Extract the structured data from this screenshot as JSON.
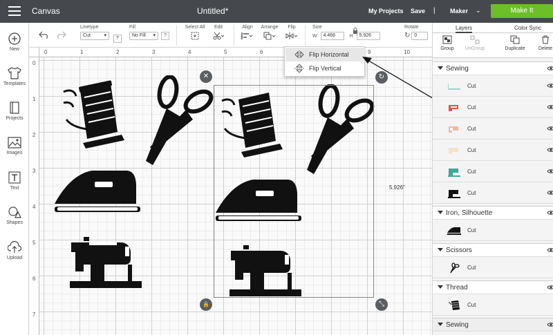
{
  "topbar": {
    "app_label": "Canvas",
    "doc_title": "Untitled*",
    "my_projects": "My Projects",
    "save": "Save",
    "separator": "|",
    "machine": "Maker",
    "machine_chevron": "⌄",
    "make_it": "Make It"
  },
  "left_tools": [
    {
      "label": "New",
      "icon": "plus-circle-icon"
    },
    {
      "label": "Templates",
      "icon": "shirt-icon"
    },
    {
      "label": "Projects",
      "icon": "book-icon"
    },
    {
      "label": "Images",
      "icon": "image-icon"
    },
    {
      "label": "Text",
      "icon": "text-icon"
    },
    {
      "label": "Shapes",
      "icon": "shapes-icon"
    },
    {
      "label": "Upload",
      "icon": "upload-icon"
    }
  ],
  "toolbar": {
    "linetype_label": "Linetype",
    "linetype_value": "Cut",
    "fill_label": "Fill",
    "fill_value": "No Fill",
    "help": "?",
    "select_all": "Select All",
    "edit": "Edit",
    "align": "Align",
    "arrange": "Arrange",
    "flip": "Flip",
    "size_label": "Size",
    "w_label": "W",
    "w_value": "4.466",
    "h_label": "H",
    "h_value": "5.926",
    "rotate_label": "Rotate",
    "rotate_value": "0"
  },
  "ruler": {
    "h_ticks": [
      "0",
      "1",
      "2",
      "3",
      "4",
      "5",
      "6",
      "7",
      "8",
      "9",
      "10"
    ],
    "v_ticks": [
      "0",
      "1",
      "2",
      "3",
      "4",
      "5",
      "6",
      "7"
    ]
  },
  "selection": {
    "height_readout": "5.926\"",
    "close_glyph": "✕",
    "rotate_glyph": "↻",
    "lock_glyph": "🔒",
    "resize_glyph": "⤡"
  },
  "flip_menu": {
    "horizontal": "Flip Horizontal",
    "vertical": "Flip Vertical"
  },
  "panel": {
    "tab_layers": "Layers",
    "tab_color_sync": "Color Sync",
    "group": "Group",
    "ungroup": "UnGroup",
    "duplicate": "Duplicate",
    "delete": "Delete",
    "groups": [
      {
        "name": "Sewing",
        "rows": [
          {
            "label": "Cut",
            "color": "#9fd4c8"
          },
          {
            "label": "Cut",
            "color": "#e8524a"
          },
          {
            "label": "Cut",
            "color": "#f2b8a0"
          },
          {
            "label": "Cut",
            "color": "#f5e0c8"
          },
          {
            "label": "Cut",
            "color": "#3ea89a"
          },
          {
            "label": "Cut",
            "color": "#111111"
          }
        ]
      },
      {
        "name": "Iron, Silhouette",
        "rows": [
          {
            "label": "Cut",
            "color": "#111111"
          }
        ]
      },
      {
        "name": "Scissors",
        "rows": [
          {
            "label": "Cut",
            "color": "#111111"
          }
        ]
      },
      {
        "name": "Thread",
        "rows": [
          {
            "label": "Cut",
            "color": "#111111"
          }
        ]
      },
      {
        "name": "Sewing",
        "rows": []
      }
    ]
  },
  "colors": {
    "topbar": "#45494d",
    "make_it": "#6cbf27",
    "handle": "#5a5e62"
  }
}
